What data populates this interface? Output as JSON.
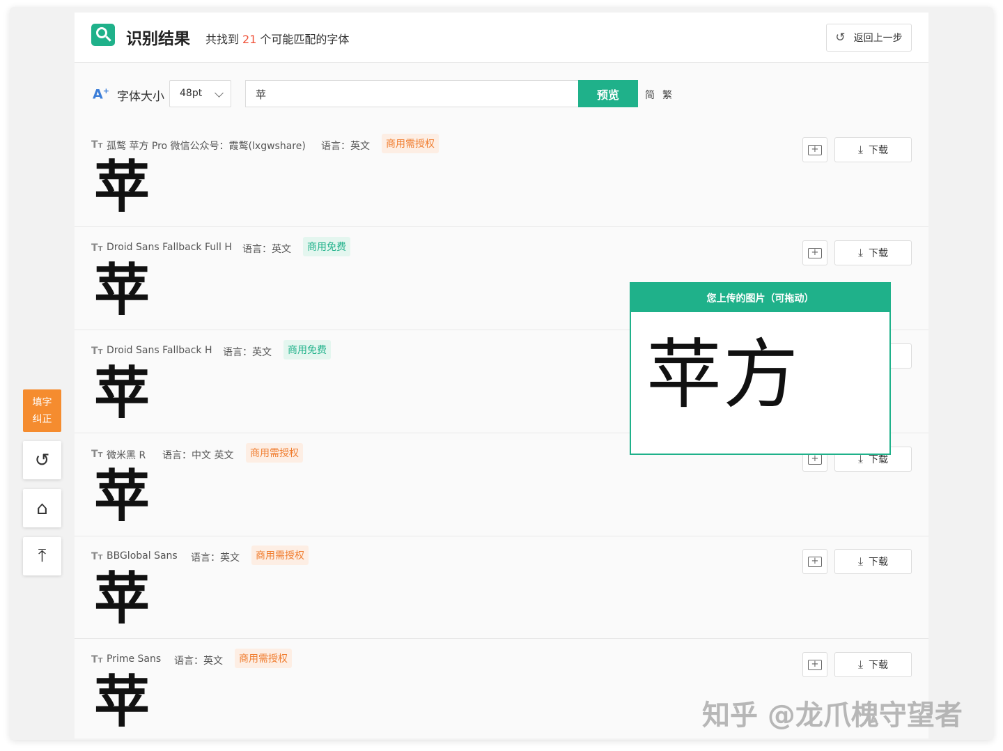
{
  "header": {
    "title": "识别结果",
    "found_prefix": "共找到",
    "found_count": "21",
    "found_suffix": "个可能匹配的字体",
    "back_label": "返回上一步"
  },
  "toolbar": {
    "size_icon": "A",
    "size_label": "字体大小",
    "size_value": "48pt",
    "preview_text": "苹",
    "preview_button": "预览",
    "simplified": "简",
    "traditional": "繁"
  },
  "actions": {
    "download_label": "下载"
  },
  "results": [
    {
      "name": "孤鹜 苹方 Pro 微信公众号：霞鹜(lxgwshare)",
      "lang": "语言：英文",
      "license": "商用需授权",
      "glyph": "苹"
    },
    {
      "name": "Droid Sans Fallback Full H",
      "lang": "语言：英文",
      "license": "商用免费",
      "glyph": "苹"
    },
    {
      "name": "Droid Sans Fallback H",
      "lang": "语言：英文",
      "license": "商用免费",
      "glyph": "苹"
    },
    {
      "name": "微米黑 R",
      "lang": "语言：中文 英文",
      "license": "商用需授权",
      "glyph": "苹"
    },
    {
      "name": "BBGlobal Sans",
      "lang": "语言：英文",
      "license": "商用需授权",
      "glyph": "苹"
    },
    {
      "name": "Prime Sans",
      "lang": "语言：英文",
      "license": "商用需授权",
      "glyph": "苹"
    }
  ],
  "side_tools": {
    "fill_line1": "填字",
    "fill_line2": "纠正",
    "undo_icon": "undo-icon",
    "home_icon": "home-icon",
    "top_icon": "back-to-top-icon"
  },
  "popup": {
    "title": "您上传的图片（可拖动）",
    "image_text": "苹方"
  },
  "watermark": "知乎 @龙爪槐守望者",
  "colors": {
    "accent": "#1fb18a",
    "count": "#f0533a",
    "paid_badge": "#f07d2f",
    "fill_button": "#f58c2f"
  }
}
